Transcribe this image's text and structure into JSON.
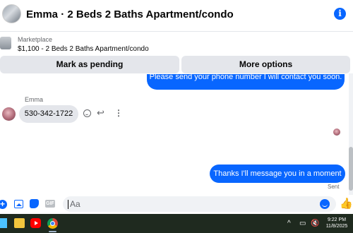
{
  "header": {
    "title": "Emma · 2 Beds 2 Baths Apartment/condo",
    "info_icon": "info-icon",
    "info_glyph": "i"
  },
  "listing": {
    "label": "Marketplace",
    "item": "$1,100 - 2 Beds 2 Baths Apartment/condo"
  },
  "actions": {
    "pending_label": "Mark as pending",
    "options_label": "More options"
  },
  "messages": {
    "outgoing_partial": "Please send your phone number I will contact you soon.",
    "sender_name": "Emma",
    "incoming": "530-342-1722",
    "outgoing": "Thanks I'll message you in a moment",
    "status": "Sent"
  },
  "message_actions": {
    "reply_glyph": "↩",
    "more_glyph": "⋮"
  },
  "composer": {
    "placeholder": "Aa",
    "plus_glyph": "+",
    "gif_label": "GIF",
    "like_glyph": "👍"
  },
  "taskbar": {
    "time": "9:22 PM",
    "date": "11/8/2025",
    "tray_up_glyph": "^",
    "tray_net_glyph": "▭",
    "tray_vol_glyph": "🔇"
  },
  "colors": {
    "accent": "#0866ff",
    "bubble_in": "#e4e6eb",
    "taskbar": "#1f2a1f"
  }
}
